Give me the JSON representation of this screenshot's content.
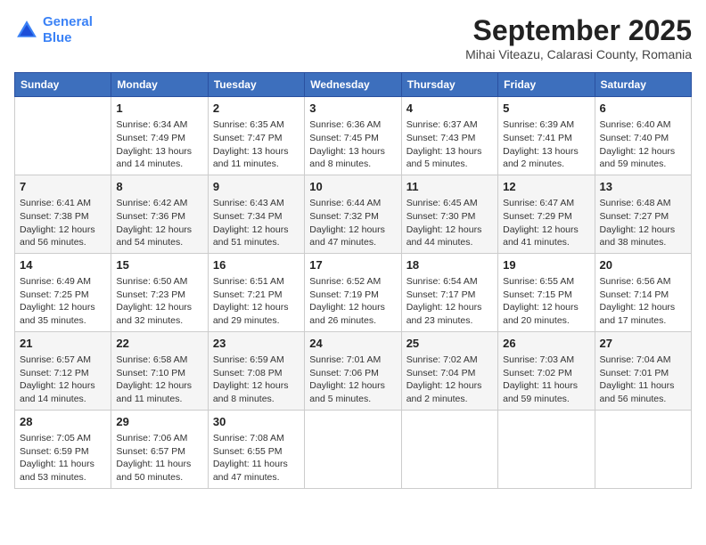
{
  "header": {
    "logo_line1": "General",
    "logo_line2": "Blue",
    "month": "September 2025",
    "location": "Mihai Viteazu, Calarasi County, Romania"
  },
  "weekdays": [
    "Sunday",
    "Monday",
    "Tuesday",
    "Wednesday",
    "Thursday",
    "Friday",
    "Saturday"
  ],
  "weeks": [
    [
      {
        "day": "",
        "info": ""
      },
      {
        "day": "1",
        "info": "Sunrise: 6:34 AM\nSunset: 7:49 PM\nDaylight: 13 hours\nand 14 minutes."
      },
      {
        "day": "2",
        "info": "Sunrise: 6:35 AM\nSunset: 7:47 PM\nDaylight: 13 hours\nand 11 minutes."
      },
      {
        "day": "3",
        "info": "Sunrise: 6:36 AM\nSunset: 7:45 PM\nDaylight: 13 hours\nand 8 minutes."
      },
      {
        "day": "4",
        "info": "Sunrise: 6:37 AM\nSunset: 7:43 PM\nDaylight: 13 hours\nand 5 minutes."
      },
      {
        "day": "5",
        "info": "Sunrise: 6:39 AM\nSunset: 7:41 PM\nDaylight: 13 hours\nand 2 minutes."
      },
      {
        "day": "6",
        "info": "Sunrise: 6:40 AM\nSunset: 7:40 PM\nDaylight: 12 hours\nand 59 minutes."
      }
    ],
    [
      {
        "day": "7",
        "info": "Sunrise: 6:41 AM\nSunset: 7:38 PM\nDaylight: 12 hours\nand 56 minutes."
      },
      {
        "day": "8",
        "info": "Sunrise: 6:42 AM\nSunset: 7:36 PM\nDaylight: 12 hours\nand 54 minutes."
      },
      {
        "day": "9",
        "info": "Sunrise: 6:43 AM\nSunset: 7:34 PM\nDaylight: 12 hours\nand 51 minutes."
      },
      {
        "day": "10",
        "info": "Sunrise: 6:44 AM\nSunset: 7:32 PM\nDaylight: 12 hours\nand 47 minutes."
      },
      {
        "day": "11",
        "info": "Sunrise: 6:45 AM\nSunset: 7:30 PM\nDaylight: 12 hours\nand 44 minutes."
      },
      {
        "day": "12",
        "info": "Sunrise: 6:47 AM\nSunset: 7:29 PM\nDaylight: 12 hours\nand 41 minutes."
      },
      {
        "day": "13",
        "info": "Sunrise: 6:48 AM\nSunset: 7:27 PM\nDaylight: 12 hours\nand 38 minutes."
      }
    ],
    [
      {
        "day": "14",
        "info": "Sunrise: 6:49 AM\nSunset: 7:25 PM\nDaylight: 12 hours\nand 35 minutes."
      },
      {
        "day": "15",
        "info": "Sunrise: 6:50 AM\nSunset: 7:23 PM\nDaylight: 12 hours\nand 32 minutes."
      },
      {
        "day": "16",
        "info": "Sunrise: 6:51 AM\nSunset: 7:21 PM\nDaylight: 12 hours\nand 29 minutes."
      },
      {
        "day": "17",
        "info": "Sunrise: 6:52 AM\nSunset: 7:19 PM\nDaylight: 12 hours\nand 26 minutes."
      },
      {
        "day": "18",
        "info": "Sunrise: 6:54 AM\nSunset: 7:17 PM\nDaylight: 12 hours\nand 23 minutes."
      },
      {
        "day": "19",
        "info": "Sunrise: 6:55 AM\nSunset: 7:15 PM\nDaylight: 12 hours\nand 20 minutes."
      },
      {
        "day": "20",
        "info": "Sunrise: 6:56 AM\nSunset: 7:14 PM\nDaylight: 12 hours\nand 17 minutes."
      }
    ],
    [
      {
        "day": "21",
        "info": "Sunrise: 6:57 AM\nSunset: 7:12 PM\nDaylight: 12 hours\nand 14 minutes."
      },
      {
        "day": "22",
        "info": "Sunrise: 6:58 AM\nSunset: 7:10 PM\nDaylight: 12 hours\nand 11 minutes."
      },
      {
        "day": "23",
        "info": "Sunrise: 6:59 AM\nSunset: 7:08 PM\nDaylight: 12 hours\nand 8 minutes."
      },
      {
        "day": "24",
        "info": "Sunrise: 7:01 AM\nSunset: 7:06 PM\nDaylight: 12 hours\nand 5 minutes."
      },
      {
        "day": "25",
        "info": "Sunrise: 7:02 AM\nSunset: 7:04 PM\nDaylight: 12 hours\nand 2 minutes."
      },
      {
        "day": "26",
        "info": "Sunrise: 7:03 AM\nSunset: 7:02 PM\nDaylight: 11 hours\nand 59 minutes."
      },
      {
        "day": "27",
        "info": "Sunrise: 7:04 AM\nSunset: 7:01 PM\nDaylight: 11 hours\nand 56 minutes."
      }
    ],
    [
      {
        "day": "28",
        "info": "Sunrise: 7:05 AM\nSunset: 6:59 PM\nDaylight: 11 hours\nand 53 minutes."
      },
      {
        "day": "29",
        "info": "Sunrise: 7:06 AM\nSunset: 6:57 PM\nDaylight: 11 hours\nand 50 minutes."
      },
      {
        "day": "30",
        "info": "Sunrise: 7:08 AM\nSunset: 6:55 PM\nDaylight: 11 hours\nand 47 minutes."
      },
      {
        "day": "",
        "info": ""
      },
      {
        "day": "",
        "info": ""
      },
      {
        "day": "",
        "info": ""
      },
      {
        "day": "",
        "info": ""
      }
    ]
  ]
}
